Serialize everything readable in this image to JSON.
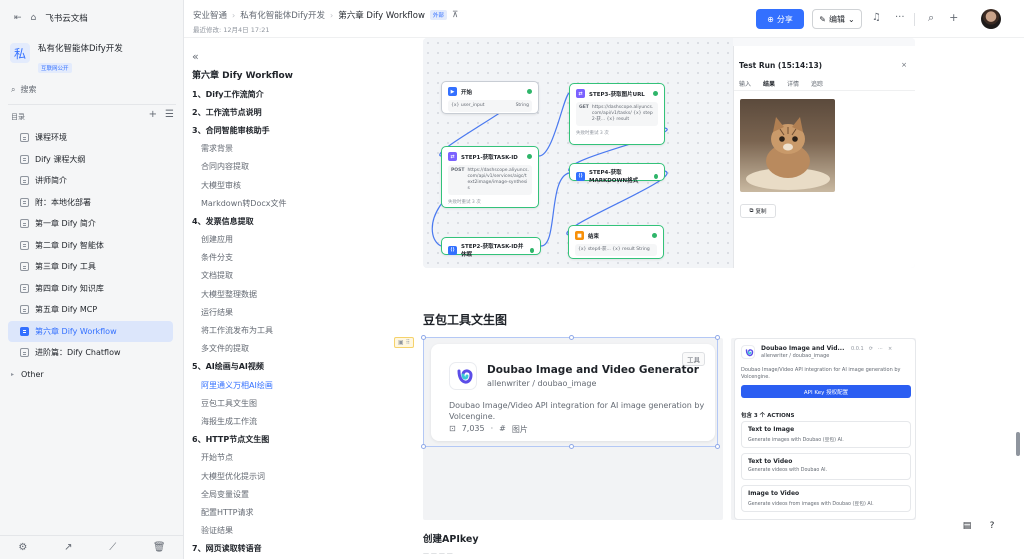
{
  "sidebar": {
    "workspace": "飞书云文档",
    "kb_logo": "私",
    "kb_name": "私有化智能体Dify开发",
    "kb_badge": "互联网公开",
    "search_label": "搜索",
    "toc_label": "目录",
    "items": [
      {
        "label": "课程环境",
        "active": false
      },
      {
        "label": "Dify 课程大纲",
        "active": false
      },
      {
        "label": "讲师简介",
        "active": false
      },
      {
        "label": "附：本地化部署",
        "active": false
      },
      {
        "label": "第一章 Dify 简介",
        "active": false
      },
      {
        "label": "第二章 Dify 智能体",
        "active": false
      },
      {
        "label": "第三章 Dify 工具",
        "active": false
      },
      {
        "label": "第四章 Dify 知识库",
        "active": false
      },
      {
        "label": "第五章 Dify MCP",
        "active": false
      },
      {
        "label": "第六章 Dify Workflow",
        "active": true
      },
      {
        "label": "进阶篇：Dify Chatflow",
        "active": false
      },
      {
        "label": "Other",
        "active": false
      }
    ]
  },
  "header": {
    "crumbs": [
      "安业智通",
      "私有化智能体Dify开发",
      "第六章 Dify Workflow"
    ],
    "external_badge": "外部",
    "modified": "最近修改: 12月4日 17:21",
    "share_label": "分享",
    "edit_label": "编辑"
  },
  "outline": {
    "title": "第六章 Dify Workflow",
    "items": [
      {
        "label": "1、Dify工作流简介",
        "level": 1
      },
      {
        "label": "2、工作流节点说明",
        "level": 1
      },
      {
        "label": "3、合同智能审核助手",
        "level": 1
      },
      {
        "label": "需求背景",
        "level": 2
      },
      {
        "label": "合同内容提取",
        "level": 2
      },
      {
        "label": "大模型审核",
        "level": 2
      },
      {
        "label": "Markdown转Docx文件",
        "level": 2
      },
      {
        "label": "4、发票信息提取",
        "level": 1
      },
      {
        "label": "创建应用",
        "level": 2
      },
      {
        "label": "条件分支",
        "level": 2
      },
      {
        "label": "文档提取",
        "level": 2
      },
      {
        "label": "大模型整理数据",
        "level": 2
      },
      {
        "label": "运行结果",
        "level": 2
      },
      {
        "label": "将工作流发布为工具",
        "level": 2
      },
      {
        "label": "多文件的提取",
        "level": 2
      },
      {
        "label": "5、AI绘画与AI视频",
        "level": 1
      },
      {
        "label": "阿里通义万相AI绘画",
        "level": 2,
        "active": true
      },
      {
        "label": "豆包工具文生图",
        "level": 2
      },
      {
        "label": "海报生成工作流",
        "level": 2
      },
      {
        "label": "6、HTTP节点文生图",
        "level": 1
      },
      {
        "label": "开始节点",
        "level": 2
      },
      {
        "label": "大模型优化提示词",
        "level": 2
      },
      {
        "label": "全局变量设置",
        "level": 2
      },
      {
        "label": "配置HTTP请求",
        "level": 2
      },
      {
        "label": "验证结果",
        "level": 2
      },
      {
        "label": "7、网页读取转语音",
        "level": 1
      }
    ]
  },
  "workflow": {
    "nodes": {
      "start": {
        "title": "开始",
        "body": "{x} user_input",
        "tag": "String"
      },
      "step1": {
        "title": "STEP1-获取TASK-ID",
        "method": "POST",
        "body": "https://dashscope.aliyuncs.com/api/v1/services/aigc/text2image/image-synthesis",
        "foot": "失败时重试 3 次"
      },
      "step2": {
        "title": "STEP2-获取TASK-ID并休眠"
      },
      "step3": {
        "title": "STEP3-获取图片URL",
        "method": "GET",
        "body": "https://dashscope.aliyuncs.com/api/v1/tasks/ {x} step2-获... {x} result",
        "foot": "失败时重试 3 次"
      },
      "step4": {
        "title": "STEP4-获取MARKDOWN格式"
      },
      "end": {
        "title": "结束",
        "body": "{x} step4-获... {x} result String"
      }
    },
    "test_run": {
      "title": "Test Run (15:14:13)",
      "tabs": [
        "输入",
        "结果",
        "详情",
        "追踪"
      ],
      "copy_label": "复制"
    }
  },
  "doc": {
    "section_title": "豆包工具文生图",
    "tool_card": {
      "tag": "工具",
      "title": "Doubao Image and Video Generator",
      "subtitle": "allenwriter / doubao_image",
      "description": "Doubao Image/Video API integration for AI image generation by Volcengine.",
      "downloads": "7,035",
      "category": "图片"
    },
    "plugin_detail": {
      "title": "Doubao Image and Vid...",
      "version": "0.0.1",
      "meta": "allenwriter / doubao_image",
      "description": "Doubao Image/Video API integration for AI image generation by Volcengine.",
      "button": "API Key 授权配置",
      "actions_label": "包含 3 个 ACTIONS",
      "actions": [
        {
          "title": "Text to Image",
          "desc": "Generate images with Doubao (豆包) AI."
        },
        {
          "title": "Text to Video",
          "desc": "Generate videos with Doubao AI."
        },
        {
          "title": "Image to Video",
          "desc": "Generate videos from images with Doubao (豆包) AI."
        }
      ]
    },
    "next_heading": "创建APIkey"
  },
  "colors": {
    "accent": "#3370ff",
    "active_bg": "#dce6fb",
    "node_ok": "#2fb56a"
  }
}
